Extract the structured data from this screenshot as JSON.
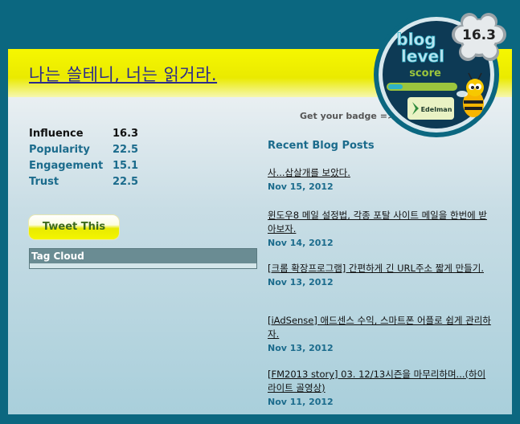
{
  "blog": {
    "title": "나는 쓸테니, 너는 읽거라."
  },
  "badge": {
    "logo_line1": "blog",
    "logo_line2": "level",
    "logo_line3": "score",
    "sponsor": "Edelman",
    "score": "16.3",
    "get_badge_label": "Get your badge =>",
    "colors": {
      "ring": "#0b6780",
      "disc": "#0d3a55",
      "accent": "#2fb3c8",
      "score_bar": "#9bc53d"
    }
  },
  "stats": [
    {
      "label": "Influence",
      "value": "16.3"
    },
    {
      "label": "Popularity",
      "value": "22.5"
    },
    {
      "label": "Engagement",
      "value": "15.1"
    },
    {
      "label": "Trust",
      "value": "22.5"
    }
  ],
  "tweet_button": {
    "label": "Tweet This"
  },
  "tag_cloud": {
    "heading": "Tag Cloud"
  },
  "recent_posts": {
    "heading": "Recent Blog Posts",
    "items": [
      {
        "title": "사...삽살개를 보았다.",
        "date": "Nov 15, 2012"
      },
      {
        "title": "윈도우8 메일 설정법, 각종 포탈 사이트 메일을 한번에 받아보자.",
        "date": "Nov 14, 2012"
      },
      {
        "title": "[크롬 확장프로그램] 간편하게 긴 URL주소 짧게 만들기.",
        "date": "Nov 13, 2012"
      },
      {
        "title": "[iAdSense] 애드센스 수익, 스마트폰 어플로 쉽게 관리하자.",
        "date": "Nov 13, 2012"
      },
      {
        "title": "[FM2013 story] 03. 12/13시즌을 마무리하며...(하이라이트 골영상)",
        "date": "Nov 11, 2012"
      }
    ]
  },
  "colors": {
    "page_bg": "#0b6780",
    "banner": "#f6f700",
    "title": "#2b2b8c",
    "link_blue": "#1b6b8c"
  }
}
